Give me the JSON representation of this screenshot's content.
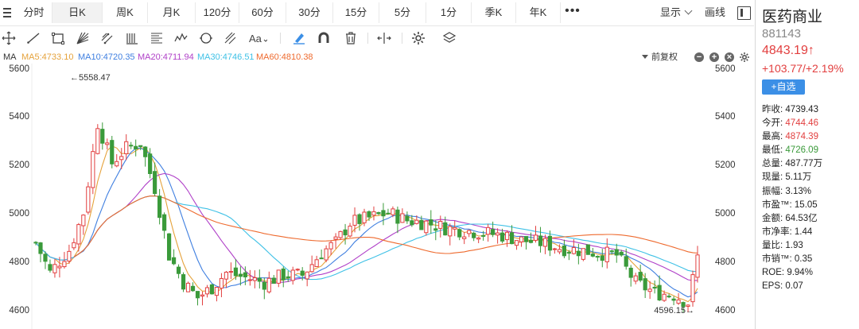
{
  "tabs": [
    {
      "label": "分时",
      "active": false
    },
    {
      "label": "日K",
      "active": true
    },
    {
      "label": "周K",
      "active": false
    },
    {
      "label": "月K",
      "active": false
    },
    {
      "label": "120分",
      "active": false
    },
    {
      "label": "60分",
      "active": false
    },
    {
      "label": "30分",
      "active": false
    },
    {
      "label": "15分",
      "active": false
    },
    {
      "label": "5分",
      "active": false
    },
    {
      "label": "1分",
      "active": false
    },
    {
      "label": "季K",
      "active": false
    },
    {
      "label": "年K",
      "active": false
    }
  ],
  "more_label": "•••",
  "display_label": "显示",
  "draw_label": "画线",
  "toolbar_icons": [
    "move-icon",
    "line-icon",
    "rectangle-icon",
    "fan-icon",
    "channel-icon",
    "vertical-lines-icon",
    "fibonacci-icon",
    "wave-icon",
    "cycle-icon",
    "parallel-icon",
    "text-icon",
    "highlighter-icon",
    "magnet-icon",
    "trash-icon",
    "range-icon",
    "settings-icon",
    "layers-icon"
  ],
  "indicator": {
    "label": "MA",
    "ma": [
      {
        "text": "MA5:4733.10",
        "color": "#e5a23b"
      },
      {
        "text": "MA10:4720.35",
        "color": "#3f7fe0"
      },
      {
        "text": "MA20:4711.94",
        "color": "#b040c8"
      },
      {
        "text": "MA30:4746.51",
        "color": "#3fc1e6"
      },
      {
        "text": "MA60:4810.38",
        "color": "#ee6a2e"
      }
    ],
    "adjust_label": "前复权"
  },
  "chart_data": {
    "type": "candlestick",
    "y_axis_ticks": [
      "5600",
      "5400",
      "5200",
      "5000",
      "4800",
      "4600"
    ],
    "ylim": [
      4580,
      5600
    ],
    "annotations": {
      "high_label": "5558.47",
      "low_label": "4596.15"
    },
    "up_color": "#e23f3f",
    "down_color": "#3a9a3a"
  },
  "stock": {
    "name": "医药商业",
    "code": "881143",
    "price": "4843.19↑",
    "change": "+103.77/+2.19%",
    "add_label": "+自选"
  },
  "stats": [
    {
      "label": "昨收:",
      "value": "4739.43",
      "tone": ""
    },
    {
      "label": "今开:",
      "value": "4744.46",
      "tone": "up"
    },
    {
      "label": "最高:",
      "value": "4874.39",
      "tone": "up"
    },
    {
      "label": "最低:",
      "value": "4726.09",
      "tone": "down"
    },
    {
      "label": "总量:",
      "value": "487.77万",
      "tone": ""
    },
    {
      "label": "现量:",
      "value": "5.11万",
      "tone": ""
    },
    {
      "label": "振幅:",
      "value": "3.13%",
      "tone": ""
    },
    {
      "label": "市盈™:",
      "value": "15.05",
      "tone": ""
    },
    {
      "label": "金额:",
      "value": "64.53亿",
      "tone": ""
    },
    {
      "label": "市净率:",
      "value": "1.44",
      "tone": ""
    },
    {
      "label": "量比:",
      "value": "1.93",
      "tone": ""
    },
    {
      "label": "市销™:",
      "value": "0.35",
      "tone": ""
    },
    {
      "label": "ROE:",
      "value": "9.94%",
      "tone": ""
    },
    {
      "label": "EPS:",
      "value": "0.07",
      "tone": ""
    }
  ]
}
